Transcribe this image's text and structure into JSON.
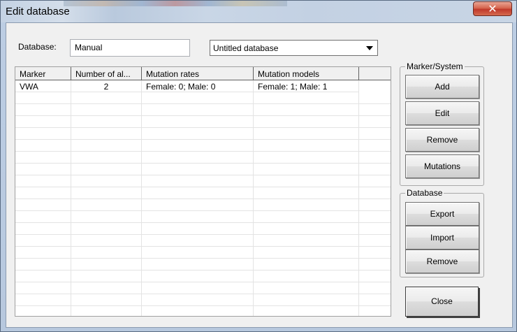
{
  "window": {
    "title": "Edit database",
    "close_glyph": "✕"
  },
  "database": {
    "label": "Database:",
    "value": "Manual",
    "selected_option": "Untitled database"
  },
  "grid": {
    "columns": [
      "Marker",
      "Number of al...",
      "Mutation rates",
      "Mutation models"
    ],
    "rows": [
      {
        "marker": "VWA",
        "alleles": "2",
        "rates": "Female: 0; Male: 0",
        "models": "Female: 1; Male: 1"
      }
    ]
  },
  "marker_system": {
    "legend": "Marker/System",
    "add": "Add",
    "edit": "Edit",
    "remove": "Remove",
    "mutations": "Mutations"
  },
  "database_group": {
    "legend": "Database",
    "export": "Export",
    "import": "Import",
    "remove": "Remove"
  },
  "close_label": "Close"
}
